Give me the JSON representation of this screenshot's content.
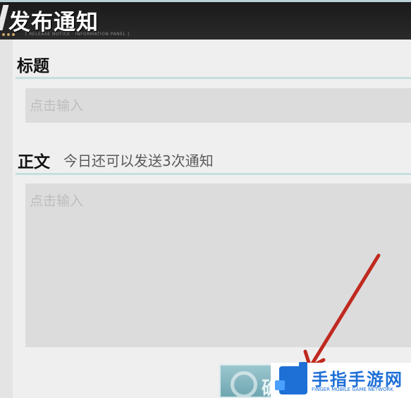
{
  "header": {
    "title": "发布通知",
    "subtitle": "[ RELEASE NOTICE · INFORMATION PANEL ]"
  },
  "form": {
    "title_label": "标题",
    "title_placeholder": "点击输入",
    "body_label": "正文",
    "body_hint": "今日还可以发送3次通知",
    "body_placeholder": "点击输入"
  },
  "confirm_button": {
    "label": "确"
  },
  "watermark": {
    "name_cn": "手指手游网",
    "name_en": "FINGER MOBILE GAME NETWORK"
  },
  "colors": {
    "header_bg": "#1f1f1f",
    "field_bg": "#dcdcdc",
    "rule": "#c6dedf",
    "arrow": "#c0291f",
    "watermark_blue": "#1e6fd6"
  }
}
